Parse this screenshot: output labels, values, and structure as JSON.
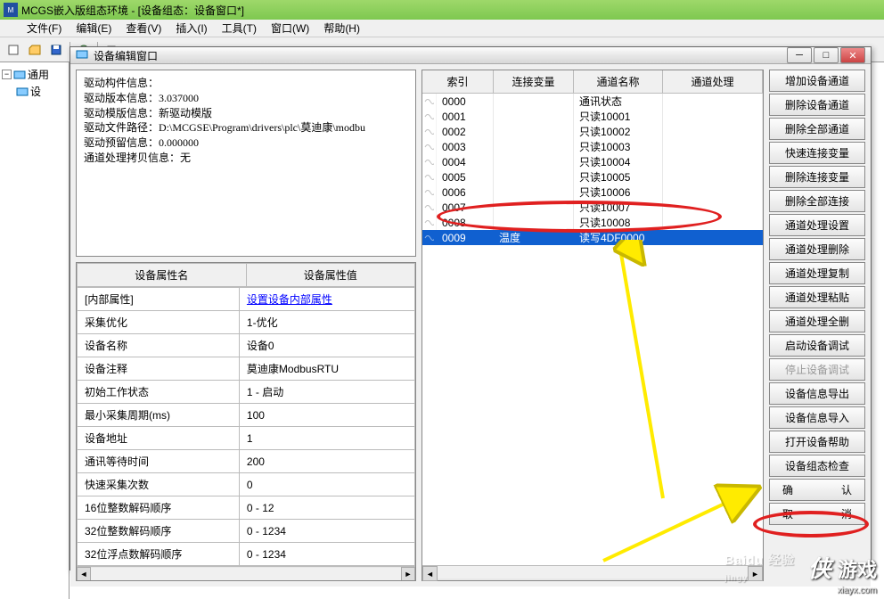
{
  "window": {
    "title": "MCGS嵌入版组态环境 - [设备组态：设备窗口*]"
  },
  "menus": [
    {
      "label": "文件(F)"
    },
    {
      "label": "编辑(E)"
    },
    {
      "label": "查看(V)"
    },
    {
      "label": "插入(I)"
    },
    {
      "label": "工具(T)"
    },
    {
      "label": "窗口(W)"
    },
    {
      "label": "帮助(H)"
    }
  ],
  "tree": {
    "root": "通用",
    "child": "设"
  },
  "dialog": {
    "title": "设备编辑窗口"
  },
  "info": {
    "l1": "驱动构件信息：",
    "l2": "驱动版本信息：3.037000",
    "l3": "驱动模版信息：新驱动模版",
    "l4": "驱动文件路径：D:\\MCGSE\\Program\\drivers\\plc\\莫迪康\\modbu",
    "l5": "驱动预留信息：0.000000",
    "l6": "通道处理拷贝信息：无"
  },
  "prop_header": {
    "name": "设备属性名",
    "value": "设备属性值"
  },
  "props": [
    {
      "name": "[内部属性]",
      "value": "设置设备内部属性",
      "link": true
    },
    {
      "name": "采集优化",
      "value": "1-优化"
    },
    {
      "name": "设备名称",
      "value": "设备0"
    },
    {
      "name": "设备注释",
      "value": "莫迪康ModbusRTU"
    },
    {
      "name": "初始工作状态",
      "value": "1 - 启动"
    },
    {
      "name": "最小采集周期(ms)",
      "value": "100"
    },
    {
      "name": "设备地址",
      "value": "1"
    },
    {
      "name": "通讯等待时间",
      "value": "200"
    },
    {
      "name": "快速采集次数",
      "value": "0"
    },
    {
      "name": "16位整数解码顺序",
      "value": "0 - 12"
    },
    {
      "name": "32位整数解码顺序",
      "value": "0 - 1234"
    },
    {
      "name": "32位浮点数解码顺序",
      "value": "0 - 1234"
    }
  ],
  "ch_header": {
    "idx": "索引",
    "var": "连接变量",
    "name": "通道名称",
    "proc": "通道处理"
  },
  "channels": [
    {
      "idx": "0000",
      "var": "",
      "name": "通讯状态",
      "proc": ""
    },
    {
      "idx": "0001",
      "var": "",
      "name": "只读10001",
      "proc": ""
    },
    {
      "idx": "0002",
      "var": "",
      "name": "只读10002",
      "proc": ""
    },
    {
      "idx": "0003",
      "var": "",
      "name": "只读10003",
      "proc": ""
    },
    {
      "idx": "0004",
      "var": "",
      "name": "只读10004",
      "proc": ""
    },
    {
      "idx": "0005",
      "var": "",
      "name": "只读10005",
      "proc": ""
    },
    {
      "idx": "0006",
      "var": "",
      "name": "只读10006",
      "proc": ""
    },
    {
      "idx": "0007",
      "var": "",
      "name": "只读10007",
      "proc": ""
    },
    {
      "idx": "0008",
      "var": "",
      "name": "只读10008",
      "proc": ""
    },
    {
      "idx": "0009",
      "var": "温度",
      "name": "读写4DF0000",
      "proc": "",
      "sel": true
    }
  ],
  "actions": {
    "add_ch": "增加设备通道",
    "del_ch": "删除设备通道",
    "del_all_ch": "删除全部通道",
    "quick_link": "快速连接变量",
    "del_link": "删除连接变量",
    "del_all_link": "删除全部连接",
    "proc_set": "通道处理设置",
    "proc_del": "通道处理删除",
    "proc_copy": "通道处理复制",
    "proc_paste": "通道处理粘贴",
    "proc_all": "通道处理全删",
    "start_dbg": "启动设备调试",
    "stop_dbg": "停止设备调试",
    "info_exp": "设备信息导出",
    "info_imp": "设备信息导入",
    "open_help": "打开设备帮助",
    "check": "设备组态检查",
    "ok_l": "确",
    "ok_r": "认",
    "cancel_l": "取",
    "cancel_r": "消"
  },
  "watermark": {
    "logo_en": "侠",
    "logo_cn": "游戏",
    "sub": "xiayx.com",
    "baidu": "Baidu 经验"
  }
}
